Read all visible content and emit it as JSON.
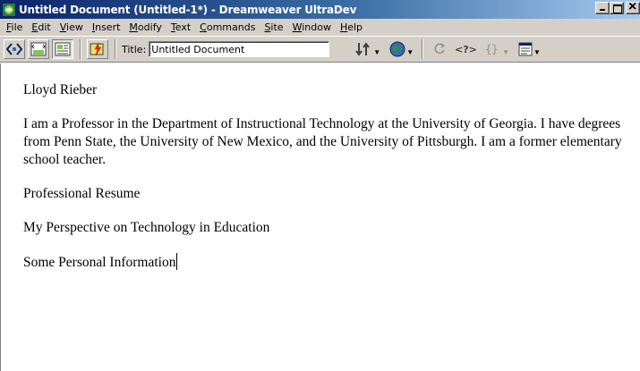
{
  "window": {
    "title": "Untitled Document (Untitled-1*) - Dreamweaver UltraDev",
    "icon": "dreamweaver-app-icon"
  },
  "menu": [
    {
      "label": "File",
      "mnemonic": "F",
      "rest": "ile"
    },
    {
      "label": "Edit",
      "mnemonic": "E",
      "rest": "dit"
    },
    {
      "label": "View",
      "mnemonic": "V",
      "rest": "iew"
    },
    {
      "label": "Insert",
      "mnemonic": "I",
      "rest": "nsert"
    },
    {
      "label": "Modify",
      "mnemonic": "M",
      "rest": "odify"
    },
    {
      "label": "Text",
      "mnemonic": "T",
      "rest": "ext"
    },
    {
      "label": "Commands",
      "mnemonic": "C",
      "rest": "ommands"
    },
    {
      "label": "Site",
      "mnemonic": "S",
      "rest": "ite"
    },
    {
      "label": "Window",
      "mnemonic": "W",
      "rest": "indow"
    },
    {
      "label": "Help",
      "mnemonic": "H",
      "rest": "elp"
    }
  ],
  "toolbar": {
    "title_label": "Title:",
    "title_value": "Untitled Document",
    "code_view_icon": "code-view-icon",
    "split_view_icon": "code-and-design-view-icon",
    "design_view_icon": "design-view-icon",
    "live_data_icon": "live-data-view-icon",
    "file_management_icon": "file-management-icon",
    "preview_icon": "preview-in-browser-icon",
    "refresh_icon": "refresh-icon",
    "server_markup_icon": "server-markup-icon",
    "code_navigation_icon": "code-navigation-icon",
    "view_options_icon": "view-options-icon"
  },
  "document": {
    "heading": "Lloyd Rieber",
    "bio": "I am a Professor in the Department of Instructional Technology at the University of Georgia. I have degrees from Penn State, the University of New Mexico, and the University of Pittsburgh. I am a former elementary school teacher.",
    "link1": "Professional Resume",
    "link2": "My Perspective on Technology in Education",
    "link3": "Some Personal Information"
  }
}
